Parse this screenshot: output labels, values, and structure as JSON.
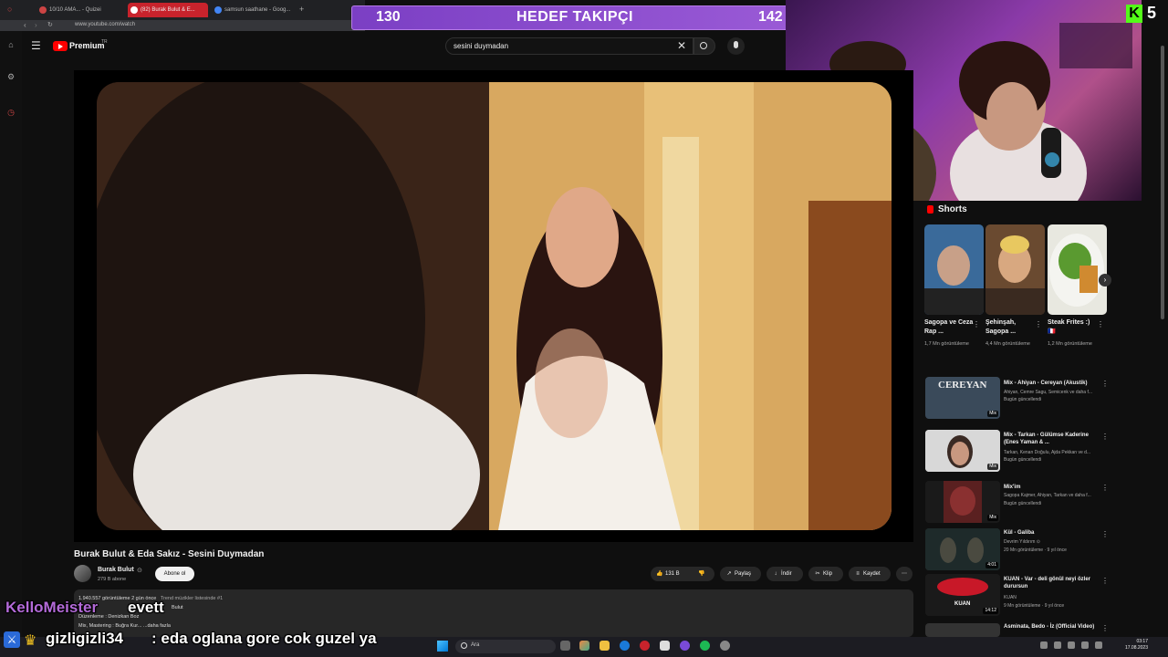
{
  "browser": {
    "tabs": [
      {
        "label": "10/10 AMA... - Quizei"
      },
      {
        "label": "(82) Burak Bulut & E..."
      },
      {
        "label": "samsun saathane - Goog..."
      }
    ],
    "url": "www.youtube.com/watch"
  },
  "header": {
    "brand": "Premium",
    "brand_sup": "TR",
    "search_value": "sesini duymadan"
  },
  "overlay": {
    "goal_left": "130",
    "goal_title": "HEDEF TAKIPÇI",
    "goal_right": "142",
    "kick_logo": "K",
    "kick_count": "5"
  },
  "video": {
    "title": "Burak Bulut & Eda Sakız - Sesini Duymadan",
    "channel": "Burak Bulut",
    "subscribers": "279 B abone",
    "subscribe_label": "Abone ol",
    "likes": "131 B",
    "share": "Paylaş",
    "download": "İndir",
    "clip": "Klip",
    "save": "Kaydet",
    "description": {
      "stats": "1.940.557 görüntüleme  2 gün önce",
      "trend": "Trend müzikler listesinde #1",
      "line2": "Bulut",
      "line3": "Düzenleme : Denizkan Boz",
      "line4": "Mix, Mastering : Buğra Kur...  ...daha fazla"
    }
  },
  "shorts": {
    "label": "Shorts",
    "items": [
      {
        "title": "Sagopa ve Ceza Rap ...",
        "views": "1,7 Mn görüntüleme",
        "color": "#4a7fb0"
      },
      {
        "title": "Şehinşah, Sagopa ...",
        "views": "4,4 Mn görüntüleme",
        "color": "#b07a40"
      },
      {
        "title": "Steak Frites :) 🇫🇷",
        "views": "1,2 Mn görüntüleme",
        "color": "#6a9a40"
      }
    ]
  },
  "recommendations": [
    {
      "title": "Mix - Ahiyan - Cereyan (Akustik)",
      "meta1": "Ahiyan, Cemre Sagu, Semicenk ve daha f...",
      "meta2": "Bugün güncellendi",
      "badge": "Mix",
      "color": "#3a4a5a"
    },
    {
      "title": "Mix - Tarkan - Gülümse Kaderine (Enes Yaman & ...",
      "meta1": "Tarkan, Kenan Doğulu, Ajda Pekkan ve d...",
      "meta2": "Bugün güncellendi",
      "badge": "Mix",
      "color": "#c8c8c8"
    },
    {
      "title": "Mix'im",
      "meta1": "Sagopa Kajmer, Ahiyan, Tarkan ve daha f...",
      "meta2": "Bugün güncellendi",
      "badge": "Mix",
      "color": "#5a2020"
    },
    {
      "title": "Kül - Galiba",
      "meta1": "Devrim Yıldırım ⊙",
      "meta2": "20 Mn görüntüleme · 9 yıl önce",
      "badge": "4:01",
      "color": "#2a3a3a"
    },
    {
      "title": "KUAN - Var - deli gönül neyi özler durursun",
      "meta1": "KUAN",
      "meta2": "9 Mn görüntüleme · 9 yıl önce",
      "badge": "14:12",
      "color": "#8a1020"
    },
    {
      "title": "Asminata, Bedo - İz (Official Video)",
      "meta1": "",
      "meta2": "",
      "badge": "",
      "color": "#333"
    }
  ],
  "chat": [
    {
      "user": "KelloMeister",
      "message": "evett"
    },
    {
      "user": "gizligizli34",
      "message": ": eda oglana gore cok guzel ya"
    }
  ],
  "taskbar": {
    "search_placeholder": "Ara",
    "time": "03:17",
    "date": "17.08.2023"
  }
}
